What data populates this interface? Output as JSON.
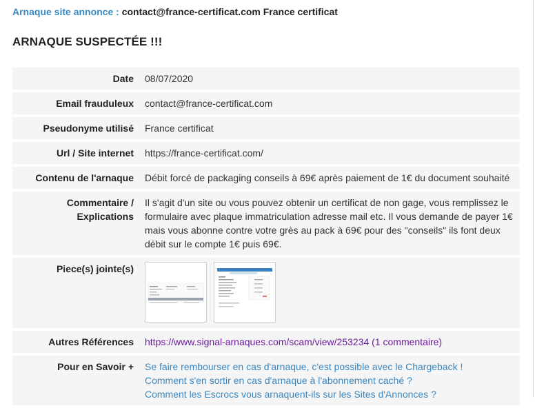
{
  "header": {
    "prefix": "Arnaque site annonce :",
    "target": "contact@france-certificat.com France certificat"
  },
  "title": "ARNAQUE SUSPECTÉE !!!",
  "details": {
    "date_label": "Date",
    "date_value": "08/07/2020",
    "email_label": "Email frauduleux",
    "email_value": "contact@france-certificat.com",
    "pseudo_label": "Pseudonyme utilisé",
    "pseudo_value": "France certificat",
    "url_label": "Url / Site internet",
    "url_value": "https://france-certificat.com/",
    "contenu_label": "Contenu de l'arnaque",
    "contenu_value": "Débit forcé de packaging conseils à 69€ après paiement de 1€ du document souhaité",
    "commentaire_label_line1": "Commentaire /",
    "commentaire_label_line2": "Explications",
    "commentaire_value": "Il s'agit d'un site ou vous pouvez obtenir un certificat de non gage, vous remplissez le formulaire avec plaque immatriculation adresse mail etc. Il vous demande de payer 1€ mais vous abonne contre votre grès au pack à 69€ pour des \"conseils\" ils font deux débit sur le compte 1€ puis 69€.",
    "pieces_label": "Piece(s) jointe(s)",
    "autres_label": "Autres Références",
    "autres_link": "https://www.signal-arnaques.com/scam/view/253234 (1 commentaire)",
    "savoir_label": "Pour en Savoir +",
    "savoir_links": [
      "Se faire rembourser en cas d'arnaque, c'est possible avec le Chargeback !",
      "Comment s'en sortir en cas d'arnaque à l'abonnement caché ?",
      "Comment les Escrocs vous arnaquent-ils sur les Sites d'Annonces ?"
    ]
  },
  "colors": {
    "accent_blue": "#3a87c0",
    "visited_link": "#6a1b9a",
    "row_bg": "#f5f5f5"
  }
}
